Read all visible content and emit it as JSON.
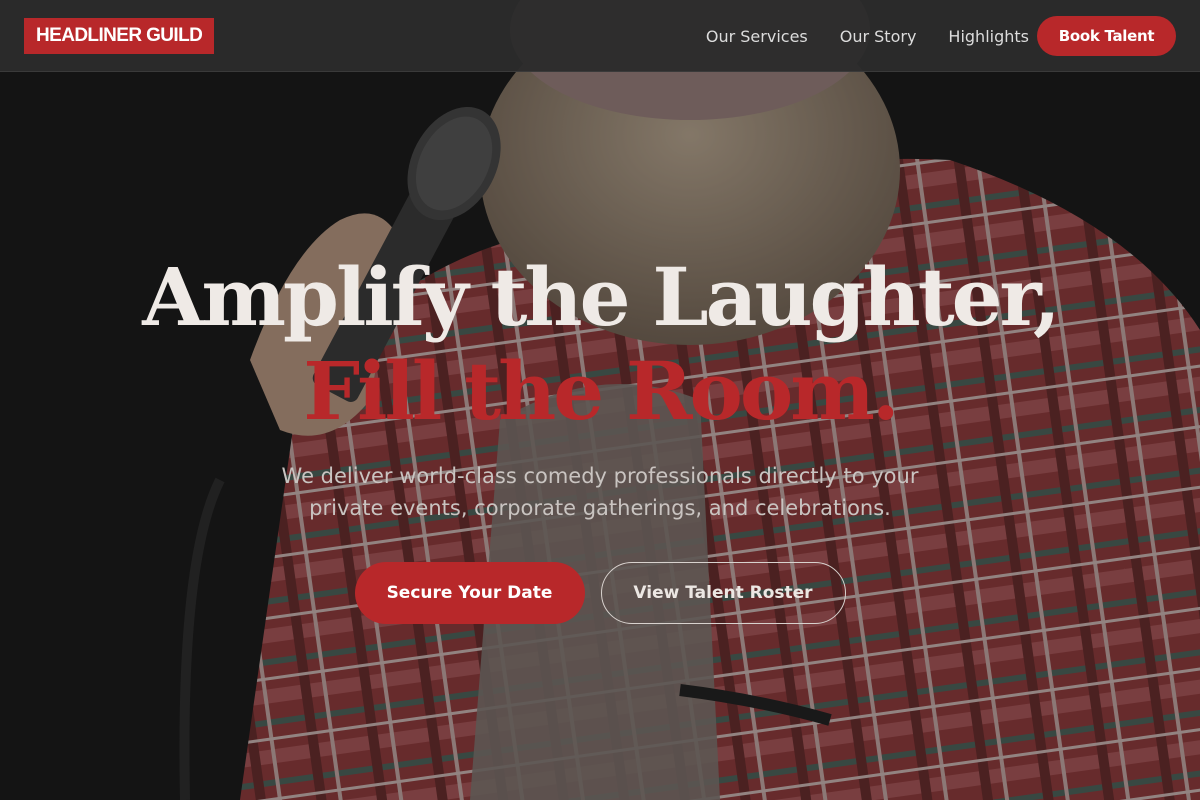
{
  "brand": {
    "name": "HEADLINER GUILD",
    "accent_color": "#b8282a"
  },
  "nav": {
    "links": [
      "Our Services",
      "Our Story",
      "Highlights"
    ],
    "cta_label": "Book Talent"
  },
  "hero": {
    "headline_line1": "Amplify the Laughter,",
    "headline_line2": "Fill the Room.",
    "subhead": "We deliver world-class comedy professionals directly to your private events, corporate gatherings, and celebrations.",
    "primary_cta": "Secure Your Date",
    "secondary_cta": "View Talent Roster",
    "background_image": "comedian-with-microphone-photo"
  }
}
